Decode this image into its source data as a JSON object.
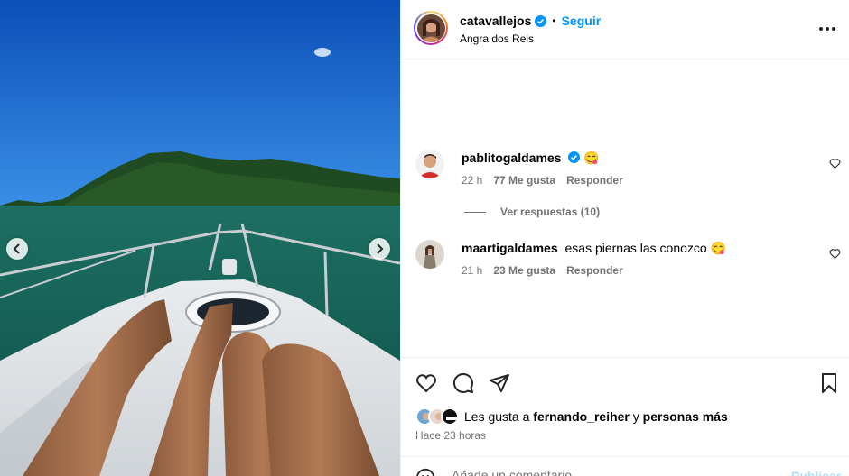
{
  "post": {
    "author": "catavallejos",
    "follow_label": "Seguir",
    "separator": "•",
    "location": "Angra dos Reis"
  },
  "comments": [
    {
      "username": "pablitogaldames",
      "text": "😋",
      "time": "22 h",
      "likes": "77 Me gusta",
      "reply_label": "Responder",
      "verified": true
    },
    {
      "username": "maartigaldames",
      "text": "esas piernas las conozco 😋",
      "time": "21 h",
      "likes": "23 Me gusta",
      "reply_label": "Responder",
      "verified": false
    }
  ],
  "view_replies_label": "Ver respuestas (10)",
  "likes_summary": {
    "prefix": "Les gusta a",
    "user": "fernando_reiher",
    "connector": "y",
    "suffix": "personas más"
  },
  "timestamp": "Hace 23 horas",
  "add_comment": {
    "placeholder": "Añade un comentario...",
    "post_label": "Publicar"
  },
  "icons": {
    "like": "heart-icon",
    "comment": "comment-icon",
    "share": "send-icon",
    "save": "bookmark-icon",
    "more": "more-options-icon",
    "prev": "chevron-left-icon",
    "next": "chevron-right-icon"
  },
  "colors": {
    "accent": "#0095f6",
    "muted": "#737373",
    "sky": "#1f6fd6",
    "sea": "#1a6b5a"
  }
}
